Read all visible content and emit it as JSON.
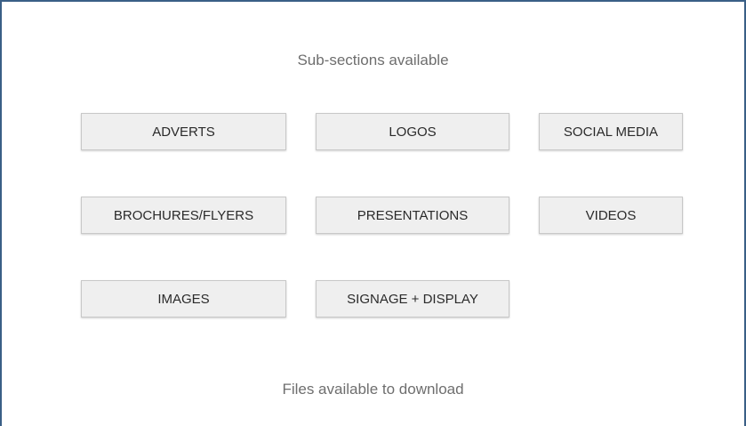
{
  "sections": {
    "subsections_heading": "Sub-sections available",
    "files_heading": "Files available to download"
  },
  "buttons": {
    "adverts": "ADVERTS",
    "logos": "LOGOS",
    "social_media": "SOCIAL MEDIA",
    "brochures_flyers": "BROCHURES/FLYERS",
    "presentations": "PRESENTATIONS",
    "videos": "VIDEOS",
    "images": "IMAGES",
    "signage_display": "SIGNAGE + DISPLAY"
  },
  "colors": {
    "frame_border": "#3a5f86",
    "button_bg": "#efefef",
    "heading_text": "#6e6e6e"
  }
}
